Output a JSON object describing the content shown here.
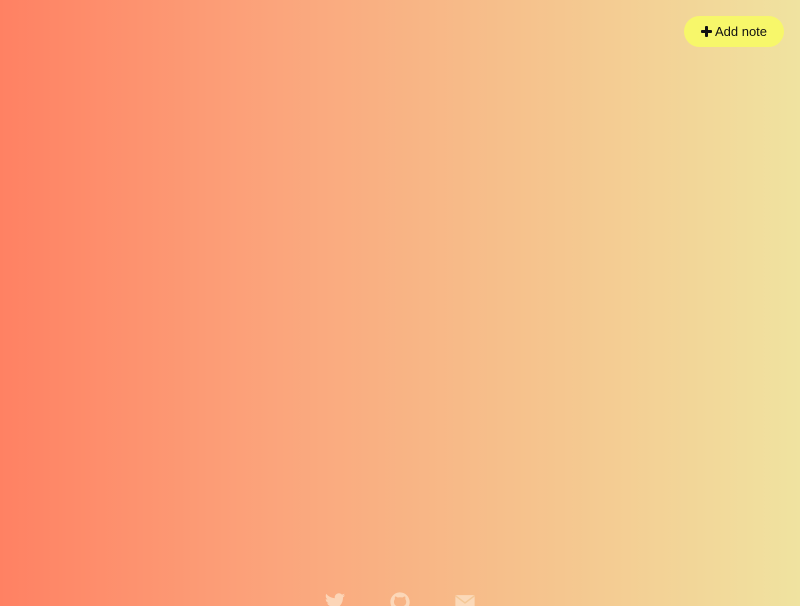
{
  "toolbar": {
    "add_note_label": "Add note",
    "add_note_icon": "plus-icon",
    "add_note_bg": "#f7f76a"
  },
  "background": {
    "gradient_start": "#ff8163",
    "gradient_end": "#f0e3a0"
  },
  "footer": {
    "icon_color": "#fce3c9",
    "links": [
      {
        "icon": "twitter-icon"
      },
      {
        "icon": "github-icon"
      },
      {
        "icon": "mail-icon"
      }
    ]
  }
}
